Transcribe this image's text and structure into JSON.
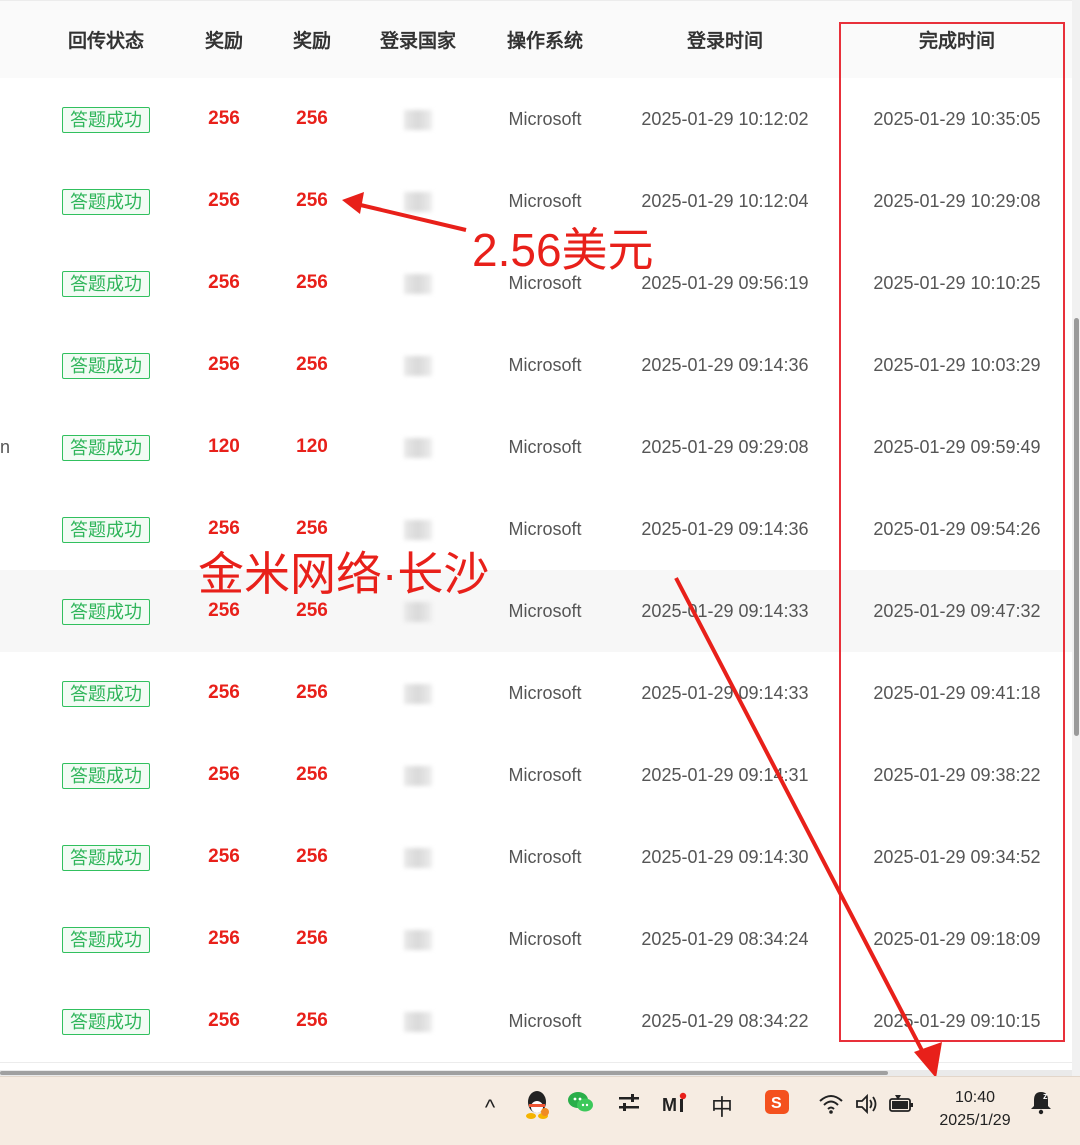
{
  "columns": [
    "回传状态",
    "奖励",
    "奖励",
    "登录国家",
    "操作系统",
    "登录时间",
    "完成时间"
  ],
  "partial_text": "n",
  "rows": [
    {
      "status": "答题成功",
      "reward1": "256",
      "reward2": "256",
      "os": "Microsoft",
      "login": "2025-01-29 10:12:02",
      "done": "2025-01-29 10:35:05"
    },
    {
      "status": "答题成功",
      "reward1": "256",
      "reward2": "256",
      "os": "Microsoft",
      "login": "2025-01-29 10:12:04",
      "done": "2025-01-29 10:29:08"
    },
    {
      "status": "答题成功",
      "reward1": "256",
      "reward2": "256",
      "os": "Microsoft",
      "login": "2025-01-29 09:56:19",
      "done": "2025-01-29 10:10:25"
    },
    {
      "status": "答题成功",
      "reward1": "256",
      "reward2": "256",
      "os": "Microsoft",
      "login": "2025-01-29 09:14:36",
      "done": "2025-01-29 10:03:29"
    },
    {
      "status": "答题成功",
      "reward1": "120",
      "reward2": "120",
      "os": "Microsoft",
      "login": "2025-01-29 09:29:08",
      "done": "2025-01-29 09:59:49"
    },
    {
      "status": "答题成功",
      "reward1": "256",
      "reward2": "256",
      "os": "Microsoft",
      "login": "2025-01-29 09:14:36",
      "done": "2025-01-29 09:54:26"
    },
    {
      "status": "答题成功",
      "reward1": "256",
      "reward2": "256",
      "os": "Microsoft",
      "login": "2025-01-29 09:14:33",
      "done": "2025-01-29 09:47:32"
    },
    {
      "status": "答题成功",
      "reward1": "256",
      "reward2": "256",
      "os": "Microsoft",
      "login": "2025-01-29 09:14:33",
      "done": "2025-01-29 09:41:18"
    },
    {
      "status": "答题成功",
      "reward1": "256",
      "reward2": "256",
      "os": "Microsoft",
      "login": "2025-01-29 09:14:31",
      "done": "2025-01-29 09:38:22"
    },
    {
      "status": "答题成功",
      "reward1": "256",
      "reward2": "256",
      "os": "Microsoft",
      "login": "2025-01-29 09:14:30",
      "done": "2025-01-29 09:34:52"
    },
    {
      "status": "答题成功",
      "reward1": "256",
      "reward2": "256",
      "os": "Microsoft",
      "login": "2025-01-29 08:34:24",
      "done": "2025-01-29 09:18:09"
    },
    {
      "status": "答题成功",
      "reward1": "256",
      "reward2": "256",
      "os": "Microsoft",
      "login": "2025-01-29 08:34:22",
      "done": "2025-01-29 09:10:15"
    }
  ],
  "annotations": {
    "amount_text": "2.56美元",
    "company_text": "金米网络·长沙",
    "color": "#e8201a"
  },
  "taskbar": {
    "chevron": "^",
    "ime_label": "中",
    "time": "10:40",
    "date": "2025/1/29",
    "icons": [
      "chevron-up-icon",
      "qq-icon",
      "wechat-icon",
      "settings-sliders-icon",
      "mail-icon",
      "ime-icon",
      "sogou-icon",
      "wifi-icon",
      "volume-icon",
      "battery-icon",
      "notification-icon"
    ]
  }
}
